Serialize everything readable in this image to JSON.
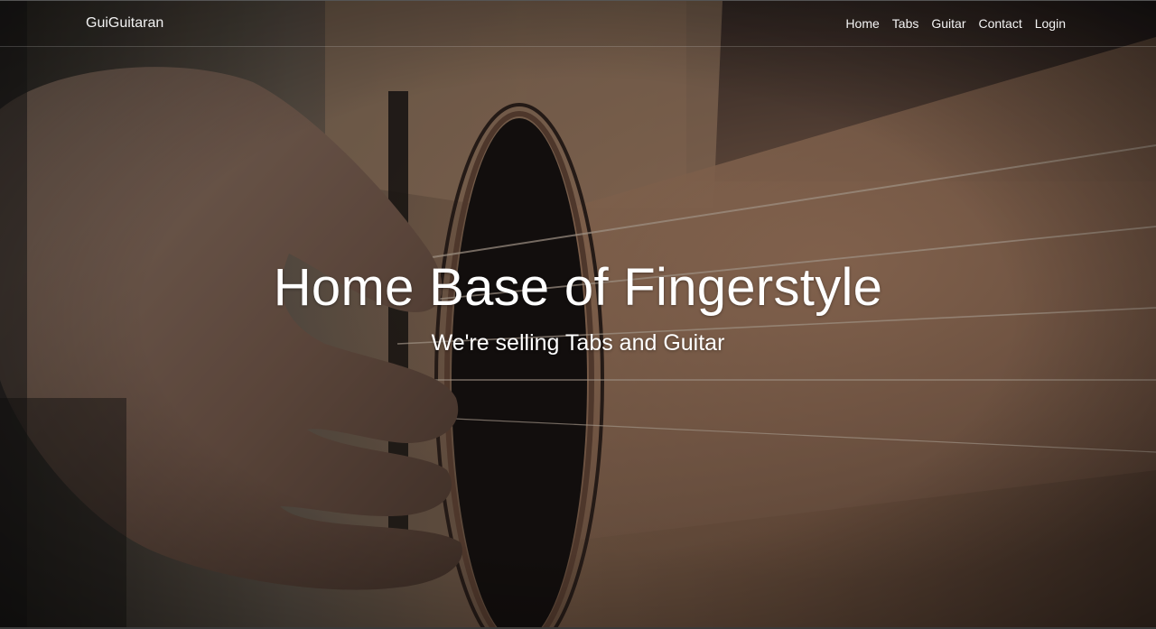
{
  "navbar": {
    "brand": "GuiGuitaran",
    "links": [
      {
        "label": "Home"
      },
      {
        "label": "Tabs"
      },
      {
        "label": "Guitar"
      },
      {
        "label": "Contact"
      },
      {
        "label": "Login"
      }
    ]
  },
  "hero": {
    "title": "Home Base of Fingerstyle",
    "subtitle": "We're selling Tabs and Guitar",
    "background": "guitar-fingerpicking-photo"
  },
  "colors": {
    "text": "#ffffff",
    "overlay": "#1a1410"
  }
}
